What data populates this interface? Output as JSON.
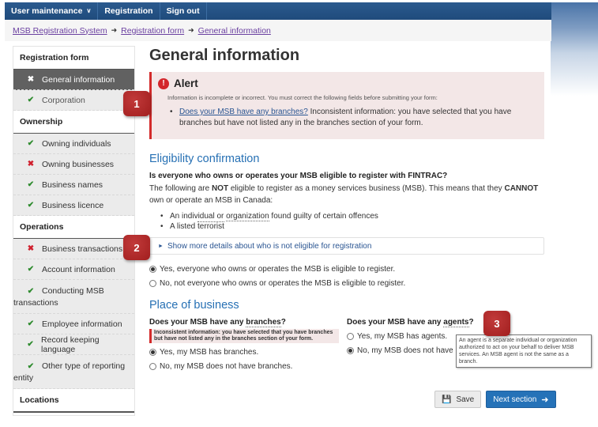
{
  "nav": {
    "items": [
      {
        "label": "User maintenance",
        "has_dropdown": true
      },
      {
        "label": "Registration"
      },
      {
        "label": "Sign out"
      }
    ]
  },
  "breadcrumb": {
    "items": [
      "MSB Registration System",
      "Registration form",
      "General information"
    ],
    "separator": "➜"
  },
  "sidebar": {
    "sections": [
      {
        "title": "Registration form",
        "items": [
          {
            "label": "General information",
            "status": "error",
            "active": true
          },
          {
            "label": "Corporation",
            "status": "ok"
          }
        ]
      },
      {
        "title": "Ownership",
        "items": [
          {
            "label": "Owning individuals",
            "status": "ok"
          },
          {
            "label": "Owning businesses",
            "status": "error"
          },
          {
            "label": "Business names",
            "status": "ok"
          },
          {
            "label": "Business licence",
            "status": "ok"
          }
        ]
      },
      {
        "title": "Operations",
        "items": [
          {
            "label": "Business transactions",
            "status": "error"
          },
          {
            "label": "Account information",
            "status": "ok"
          },
          {
            "label": "Conducting MSB",
            "label2": "transactions",
            "status": "ok"
          },
          {
            "label": "Employee information",
            "status": "ok"
          },
          {
            "label": "Record keeping language",
            "status": "ok"
          },
          {
            "label": "Other type of reporting",
            "label2": "entity",
            "status": "ok"
          }
        ]
      },
      {
        "title": "Locations",
        "items": []
      }
    ],
    "icons": {
      "ok": "✔",
      "error": "✖"
    }
  },
  "main": {
    "title": "General information",
    "alert": {
      "icon": "!",
      "title": "Alert",
      "message": "Information is incomplete or incorrect. You must correct the following fields before submitting your form:",
      "items": [
        {
          "link": "Does your MSB have any branches?",
          "text": " Inconsistent information: you have selected that you have branches but have not listed any in the branches section of your form."
        }
      ]
    },
    "eligibility": {
      "heading": "Eligibility confirmation",
      "question": "Is everyone who owns or operates your MSB eligible to register with FINTRAC?",
      "intro_1": "The following are ",
      "intro_not": "NOT",
      "intro_2": " eligible to register as a money services business (MSB). This means that they ",
      "intro_cannot": "CANNOT",
      "intro_3": " own or operate an MSB in Canada:",
      "bullets": [
        {
          "pre": "An individual or ",
          "term": "organization",
          "post": " found guilty of certain offences"
        },
        {
          "pre": "A listed ",
          "term": "terrorist",
          "post": ""
        }
      ],
      "details_label": "Show more details about who is not eligible for registration",
      "options": [
        {
          "label": "Yes, everyone who owns or operates the MSB is eligible to register.",
          "selected": true
        },
        {
          "label": "No, not everyone who owns or operates the MSB is eligible to register.",
          "selected": false
        }
      ]
    },
    "place_of_business": {
      "heading": "Place of business",
      "branches": {
        "question_pre": "Does your MSB have any ",
        "question_term": "branches",
        "question_post": "?",
        "error": "Inconsistent information: you have selected that you have branches but have not listed any in the branches section of your form.",
        "options": [
          {
            "label": "Yes, my MSB has branches.",
            "selected": true
          },
          {
            "label": "No, my MSB does not have branches.",
            "selected": false
          }
        ]
      },
      "agents": {
        "question_pre": "Does your MSB have any ",
        "question_term": "agents",
        "question_post": "?",
        "options": [
          {
            "label": "Yes, my MSB has agents.",
            "selected": false
          },
          {
            "label": "No, my MSB does not have",
            "selected": true
          }
        ],
        "tooltip": "An agent is a separate individual or organization authorized to act on your behalf to deliver MSB services.  An MSB agent is not the same as a branch."
      }
    },
    "buttons": {
      "save": "Save",
      "next": "Next section"
    }
  },
  "callouts": [
    "1",
    "2",
    "3"
  ],
  "colors": {
    "nav_bg": "#1f4b7c",
    "link": "#2a5592",
    "heading_blue": "#2670b4",
    "error_red": "#d32a2a",
    "ok_green": "#2e8b2e",
    "primary_button": "#2572b8"
  }
}
